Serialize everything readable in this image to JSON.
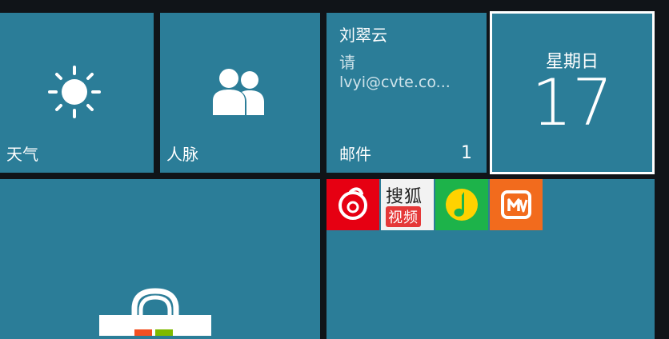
{
  "tiles": {
    "weather": {
      "label": "天气",
      "icon": "sun-icon"
    },
    "people": {
      "label": "人脉",
      "icon": "people-icon"
    },
    "mail": {
      "name": "刘翠云",
      "subject": "请",
      "address": "lvyi@cvte.co...",
      "label": "邮件",
      "count": "1"
    },
    "calendar": {
      "weekday": "星期日",
      "day": "17"
    },
    "store": {
      "icon": "shopping-bag-icon"
    }
  },
  "apps": {
    "netease": {
      "icon": "netease-music-icon",
      "color": "#e60012"
    },
    "sohu": {
      "line1": "搜狐",
      "line2": "视频",
      "color": "#f2f2f2"
    },
    "qq": {
      "icon": "qq-music-icon",
      "color": "#1db34a"
    },
    "mango": {
      "icon": "mango-tv-icon",
      "color": "#f26b1d"
    }
  },
  "colors": {
    "tile": "#2b7d98",
    "background": "#101418"
  }
}
